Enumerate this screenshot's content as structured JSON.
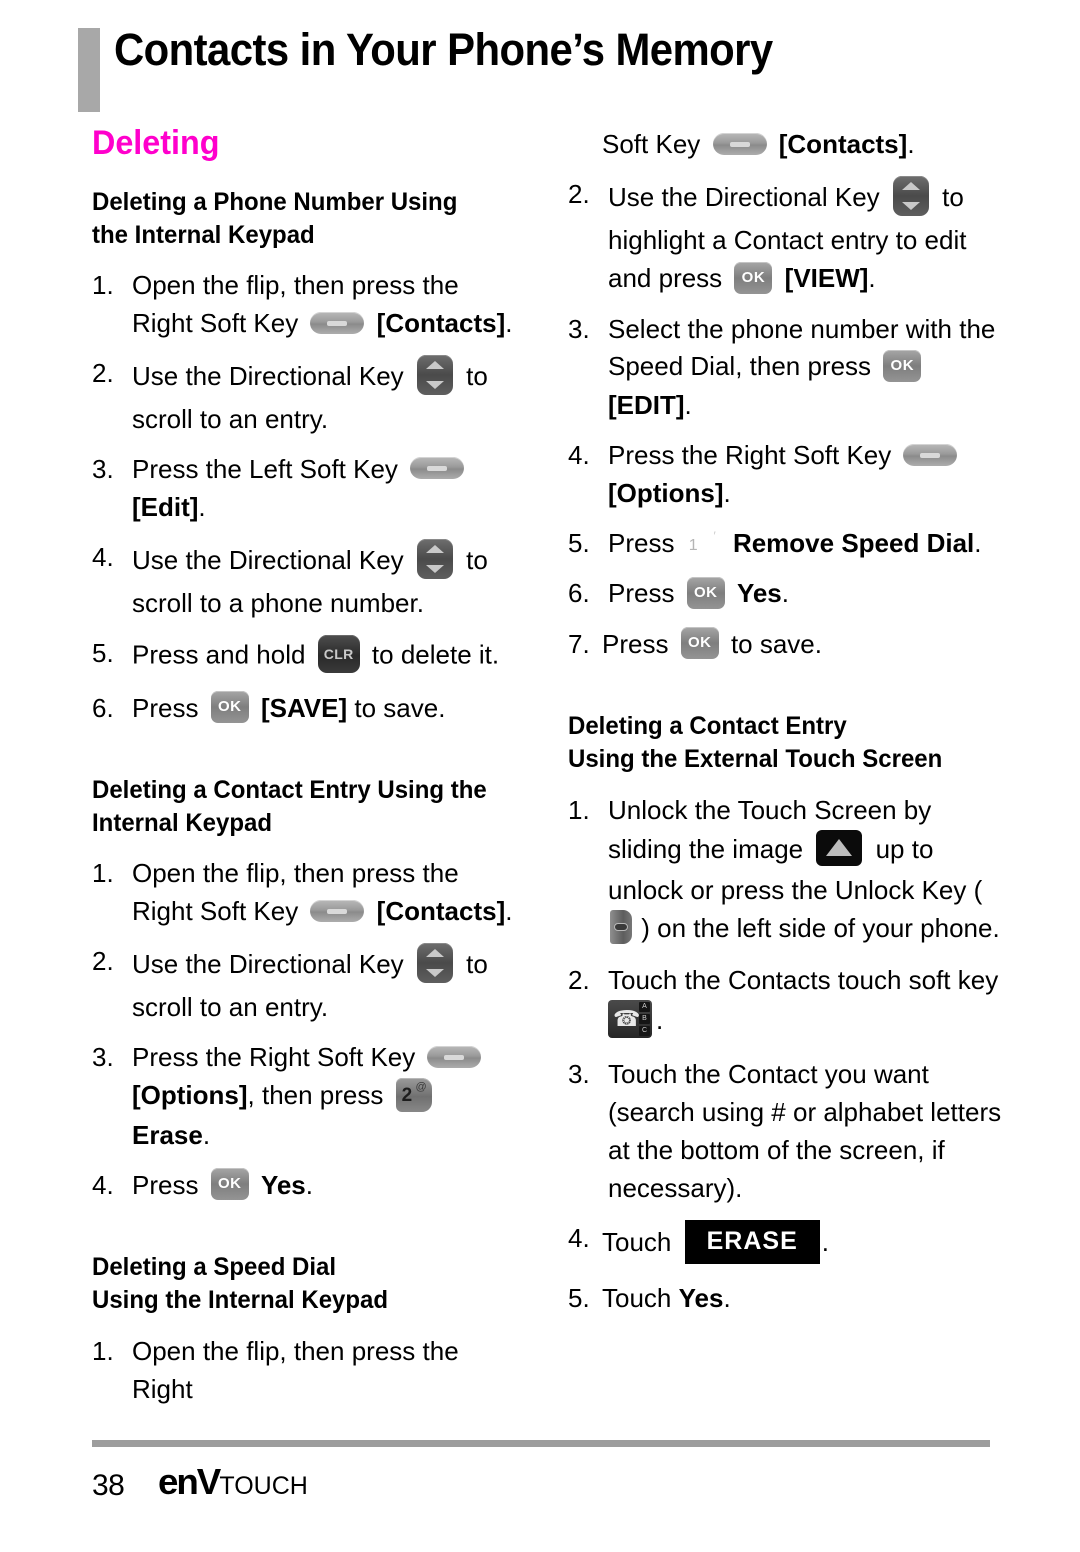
{
  "header": {
    "title": "Contacts in Your Phone’s Memory"
  },
  "left_column": {
    "section_title": "Deleting",
    "block1": {
      "heading": "Deleting a Phone Number Using the Internal Keypad",
      "steps": [
        {
          "num": "1.",
          "pre": "Open the flip, then press the Right Soft Key",
          "icon": "soft-key-icon",
          "post_bold": "[Contacts]",
          "post": "."
        },
        {
          "num": "2.",
          "pre": "Use the Directional Key",
          "icon": "directional-key-icon",
          "post": "to scroll to an entry."
        },
        {
          "num": "3.",
          "pre": "Press the Left Soft Key",
          "icon": "soft-key-icon",
          "post_bold": "[Edit]",
          "post": "."
        },
        {
          "num": "4.",
          "pre": "Use the Directional Key",
          "icon": "directional-key-icon",
          "post": "to scroll to a phone number."
        },
        {
          "num": "5.",
          "pre": "Press and hold",
          "icon": "clr-key-icon",
          "post": "to delete it."
        },
        {
          "num": "6.",
          "pre": "Press",
          "icon": "ok-key-icon",
          "post_bold": "[SAVE]",
          "post": "to save."
        }
      ]
    },
    "block2": {
      "heading": "Deleting a Contact Entry Using the Internal Keypad",
      "steps": [
        {
          "num": "1.",
          "pre": "Open the flip, then press the Right Soft Key",
          "icon": "soft-key-icon",
          "post_bold": "[Contacts]",
          "post": "."
        },
        {
          "num": "2.",
          "pre": "Use the Directional Key",
          "icon": "directional-key-icon",
          "post": "to scroll to an entry."
        },
        {
          "num": "3.",
          "pre_bold": "",
          "pre": "Press the Right Soft Key",
          "icon": "soft-key-icon",
          "mid_bold": "[Options]",
          "mid": ", then press",
          "icon2": "num-2-key-icon",
          "post_bold2": "Erase",
          "post": "."
        },
        {
          "num": "4.",
          "pre": "Press",
          "icon": "ok-key-icon",
          "post_bold": "Yes",
          "post": "."
        }
      ]
    },
    "block3": {
      "heading_line1": "Deleting a Speed Dial",
      "heading_line2": "Using the Internal Keypad",
      "steps": [
        {
          "num": "1.",
          "pre": "Open the flip, then press the Right"
        }
      ]
    }
  },
  "right_column": {
    "block1_continued": {
      "cont_line": {
        "pre": "Soft Key",
        "icon": "soft-key-icon",
        "post_bold": "[Contacts]",
        "post": "."
      },
      "steps": [
        {
          "num": "2.",
          "pre": "Use the Directional Key",
          "icon": "directional-key-icon",
          "mid": "to highlight a Contact entry to edit and press",
          "icon2": "ok-key-icon",
          "post_bold": "[VIEW]",
          "post": "."
        },
        {
          "num": "3.",
          "pre": "Select the phone number with the Speed Dial, then press",
          "icon": "ok-key-icon",
          "post_bold": "[EDIT]",
          "post": "."
        },
        {
          "num": "4.",
          "pre": "Press the Right Soft Key",
          "icon": "soft-key-icon",
          "post_bold": "[Options]",
          "post": "."
        },
        {
          "num": "5.",
          "pre": "Press",
          "icon": "num-1-key-icon",
          "post_bold": "Remove Speed Dial",
          "post": "."
        },
        {
          "num": "6.",
          "pre": "Press",
          "icon": "ok-key-icon",
          "post_bold": "Yes",
          "post": "."
        },
        {
          "num": "7.",
          "pre": "Press",
          "icon": "ok-key-icon",
          "post": "to save."
        }
      ]
    },
    "block2": {
      "heading_line1": "Deleting a Contact Entry",
      "heading_line2": "Using the External Touch Screen",
      "steps": [
        {
          "num": "1.",
          "pre": "Unlock the Touch Screen by sliding the image",
          "icon": "slide-up-icon",
          "mid": "up to unlock or press the Unlock Key (",
          "icon2": "unlock-side-key-icon",
          "post": ") on the left side of your phone."
        },
        {
          "num": "2.",
          "pre": "Touch the Contacts touch soft key",
          "icon": "contacts-touch-key-icon",
          "post": "."
        },
        {
          "num": "3.",
          "pre": "Touch the Contact you want (search using # or alphabet letters at the bottom of the screen, if necessary)."
        },
        {
          "num": "4.",
          "pre": "Touch",
          "button": "ERASE",
          "post": "."
        },
        {
          "num": "5.",
          "pre": "Touch",
          "post_bold": "Yes",
          "post": "."
        }
      ]
    }
  },
  "footer": {
    "page_number": "38",
    "logo_env": "enV",
    "logo_touch": "TOUCH"
  },
  "colors": {
    "accent_pink": "#ff00cc",
    "header_bar_gray": "#a8a8a8",
    "footer_rule_gray": "#9d9d9d"
  }
}
